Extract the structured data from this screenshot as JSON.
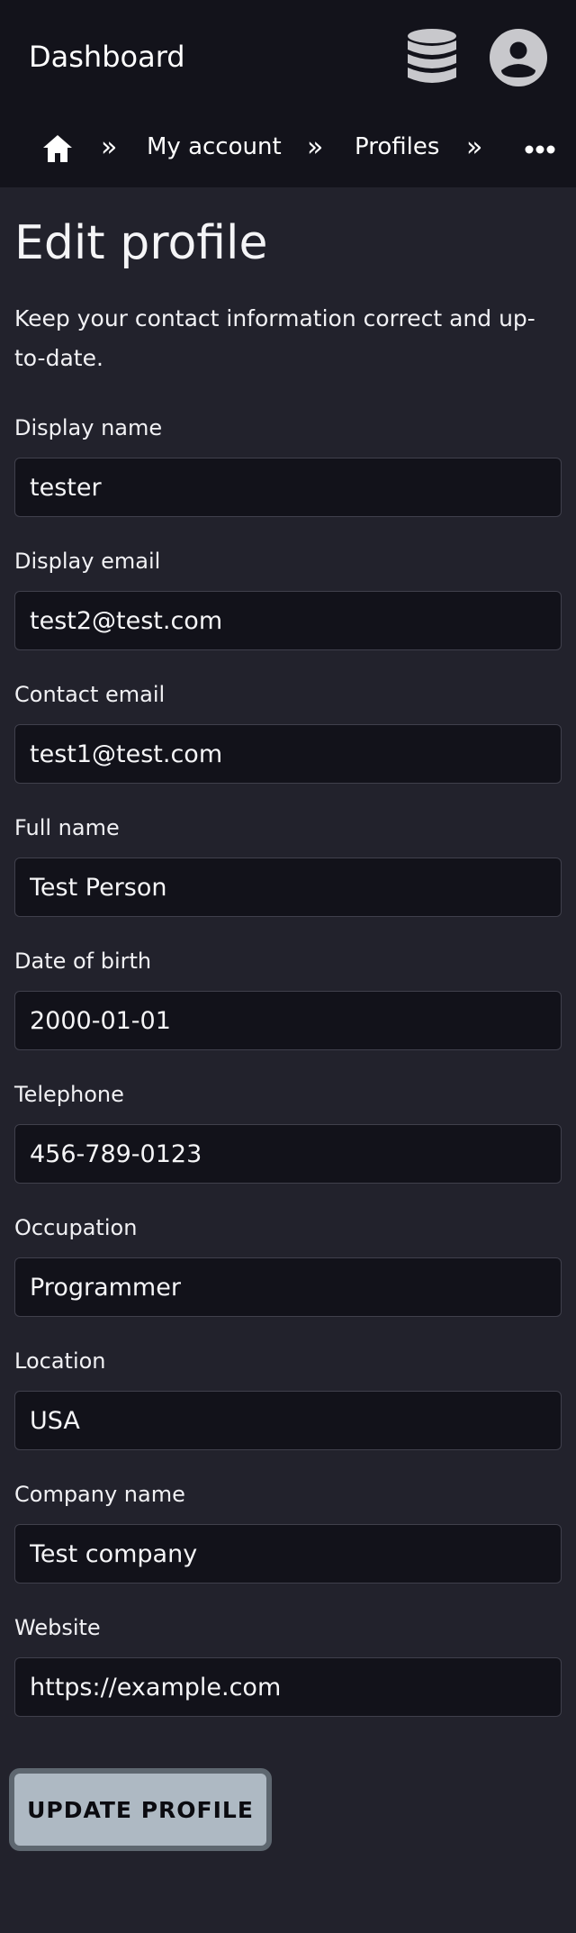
{
  "header": {
    "title": "Dashboard",
    "icons": [
      "database-icon",
      "account-circle-icon"
    ]
  },
  "breadcrumb": {
    "home_icon": "home-icon",
    "separator": "»",
    "items": [
      {
        "label": "My account"
      },
      {
        "label": "Profiles"
      }
    ],
    "more_icon": "more-horizontal-icon"
  },
  "page": {
    "title": "Edit profile",
    "intro": "Keep your contact information correct and up-to-date."
  },
  "form": {
    "fields": [
      {
        "label": "Display name",
        "value": "tester"
      },
      {
        "label": "Display email",
        "value": "test2@test.com"
      },
      {
        "label": "Contact email",
        "value": "test1@test.com"
      },
      {
        "label": "Full name",
        "value": "Test Person"
      },
      {
        "label": "Date of birth",
        "value": "2000-01-01"
      },
      {
        "label": "Telephone",
        "value": "456-789-0123"
      },
      {
        "label": "Occupation",
        "value": "Programmer"
      },
      {
        "label": "Location",
        "value": "USA"
      },
      {
        "label": "Company name",
        "value": "Test company"
      },
      {
        "label": "Website",
        "value": "https://example.com"
      }
    ],
    "submit_label": "UPDATE PROFILE"
  },
  "colors": {
    "header_bg": "#13131b",
    "page_bg": "#22222c",
    "input_bg": "#12121a",
    "button_bg": "#aeb9c3",
    "icon_fill": "#c8c8cc"
  }
}
